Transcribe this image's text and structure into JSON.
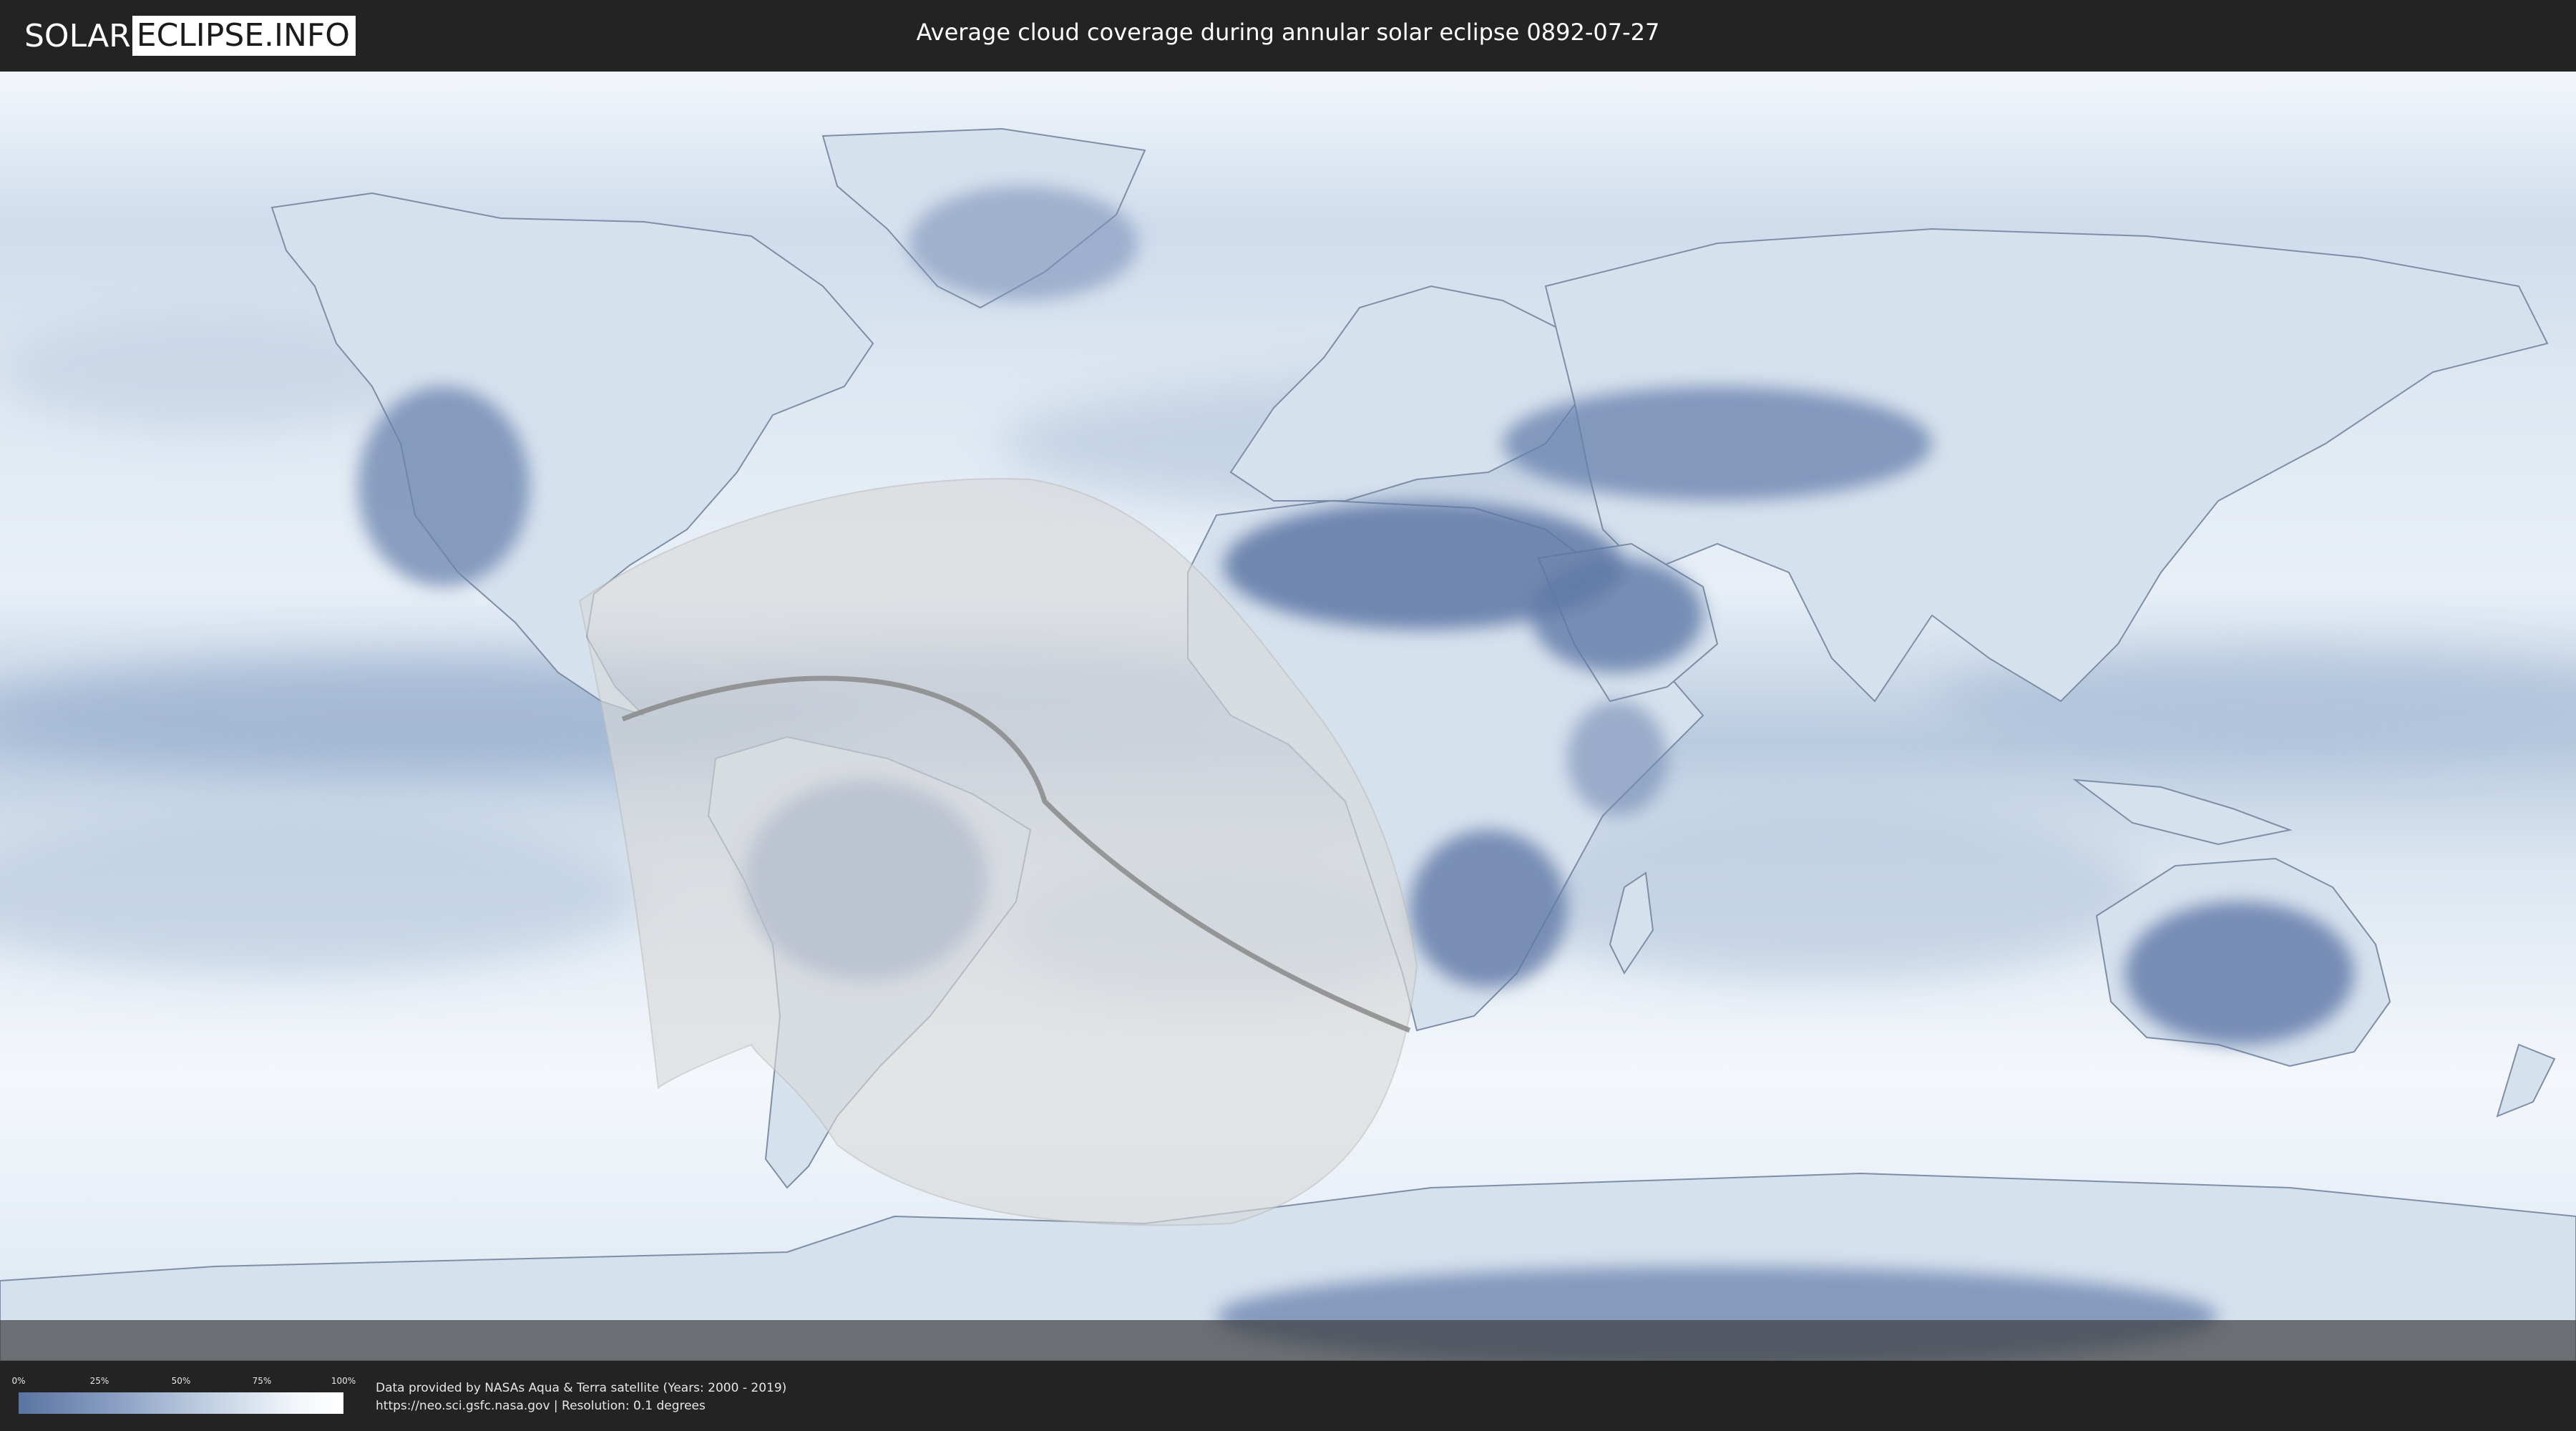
{
  "header": {
    "logo_left": "SOLAR",
    "logo_right": "ECLIPSE.INFO",
    "title": "Average cloud coverage during annular solar eclipse 0892-07-27"
  },
  "legend": {
    "ticks": [
      "0%",
      "25%",
      "50%",
      "75%",
      "100%"
    ],
    "gradient_start_color": "#5a74a2",
    "gradient_end_color": "#ffffff"
  },
  "footer": {
    "credit_line1": "Data provided by NASAs Aqua & Terra satellite (Years: 2000 - 2019)",
    "credit_line2": "https://neo.sci.gsfc.nasa.gov | Resolution: 0.1 degrees"
  },
  "map": {
    "projection": "equirectangular",
    "ocean_cloud_color": "#e9f0f7",
    "clear_sky_color": "#4f6a9a",
    "eclipse_zone_color": "#d9d9d9",
    "central_line_color": "#8a8a8a"
  }
}
